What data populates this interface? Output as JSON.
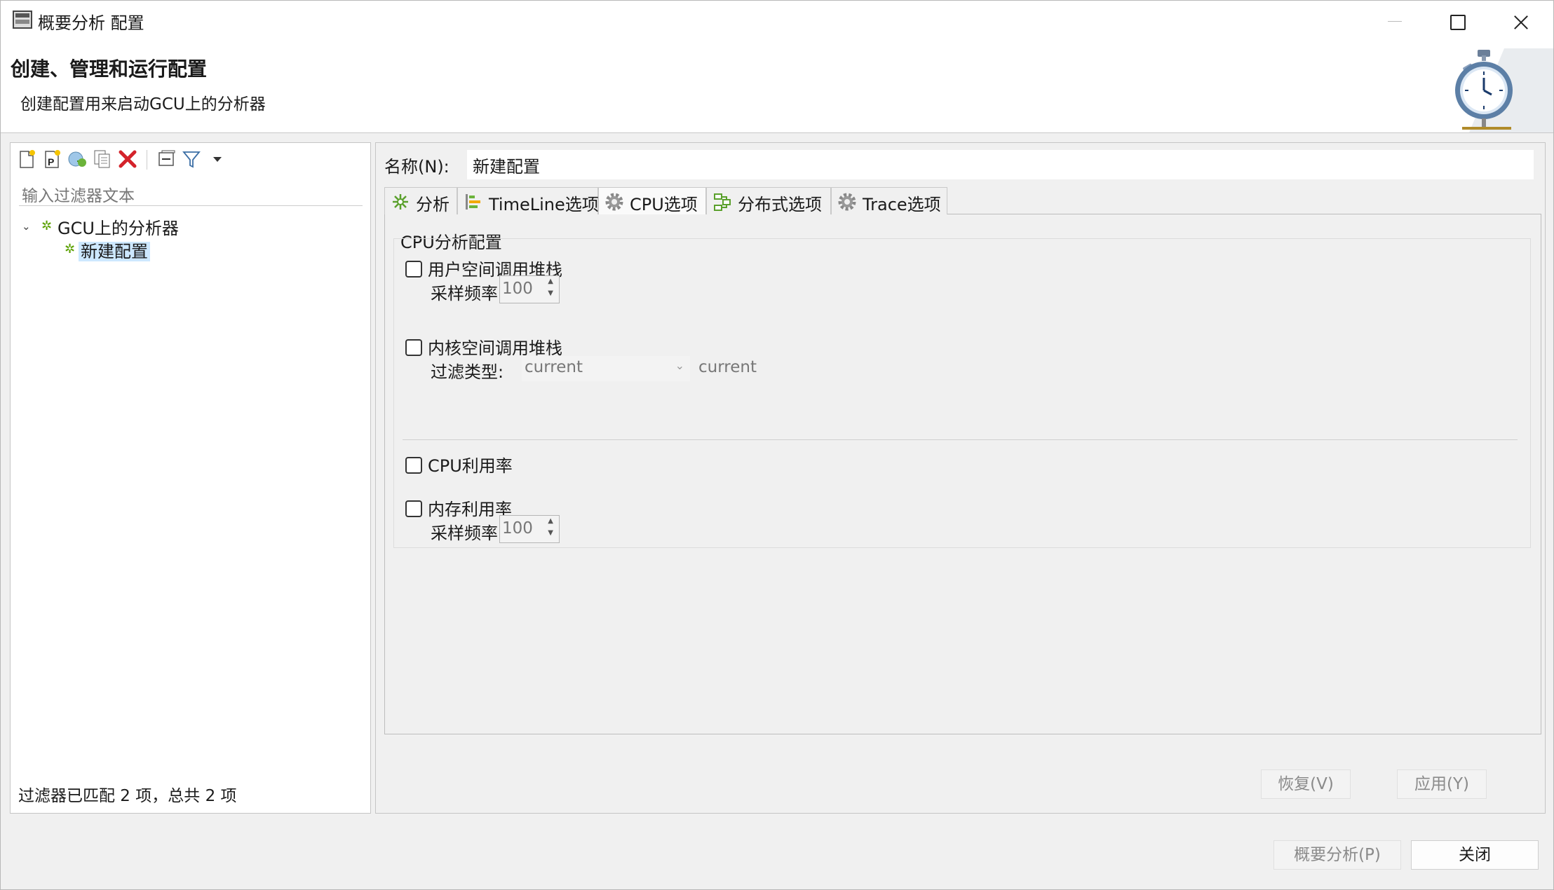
{
  "window": {
    "title": "概要分析 配置",
    "banner_title": "创建、管理和运行配置",
    "banner_subtitle": "创建配置用来启动GCU上的分析器",
    "banner_icon": "stopwatch-icon"
  },
  "left": {
    "toolbar": [
      "new-config-icon",
      "new-prototype-icon",
      "export-config-icon",
      "duplicate-config-icon",
      "delete-config-icon",
      "collapse-all-icon",
      "filter-icon",
      "view-menu-icon"
    ],
    "filter_placeholder": "输入过滤器文本",
    "tree": {
      "root": "GCU上的分析器",
      "child": "新建配置"
    },
    "status": "过滤器已匹配 2 项，总共 2 项"
  },
  "right": {
    "name_label": "名称(N):",
    "name_value": "新建配置",
    "tabs": [
      {
        "label": "分析",
        "icon": "analysis-icon"
      },
      {
        "label": "TimeLine选项",
        "icon": "timeline-icon"
      },
      {
        "label": "CPU选项",
        "icon": "cpu-gear-icon"
      },
      {
        "label": "分布式选项",
        "icon": "distributed-icon"
      },
      {
        "label": "Trace选项",
        "icon": "trace-gear-icon"
      }
    ],
    "active_tab": "CPU选项",
    "group_title": "CPU分析配置",
    "user_stack": {
      "label": "用户空间调用堆栈",
      "checked": false,
      "rate_label": "采样频率:",
      "rate_value": "100"
    },
    "kernel_stack": {
      "label": "内核空间调用堆栈",
      "checked": false,
      "filter_label": "过滤类型:",
      "filter_value": "current",
      "filter_extra": "current"
    },
    "cpu_usage": {
      "label": "CPU利用率",
      "checked": false
    },
    "mem_usage": {
      "label": "内存利用率",
      "checked": false,
      "rate_label": "采样频率:",
      "rate_value": "100"
    },
    "revert_label": "恢复(V)",
    "apply_label": "应用(Y)"
  },
  "footer": {
    "profile_label": "概要分析(P)",
    "close_label": "关闭"
  }
}
